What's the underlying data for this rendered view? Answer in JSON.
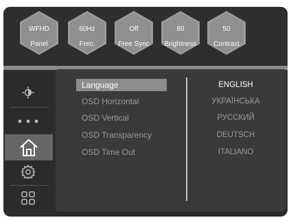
{
  "header": {
    "tiles": [
      {
        "line1": "WFHD",
        "line2": "Panel"
      },
      {
        "line1": "60Hz",
        "line2": "Frec."
      },
      {
        "line1": "Off",
        "line2": "Free Sync"
      },
      {
        "line1": "80",
        "line2": "Brightness"
      },
      {
        "line1": "50",
        "line2": "Contrast"
      }
    ]
  },
  "sidebar": {
    "items": [
      {
        "icon": "brightness-icon"
      },
      {
        "icon": "more-dots-icon"
      },
      {
        "icon": "home-icon",
        "active": true
      },
      {
        "icon": "gear-icon"
      },
      {
        "icon": "apps-grid-icon"
      }
    ]
  },
  "menu": {
    "items": [
      "Language",
      "OSD Horizontal",
      "OSD Vertical",
      "OSD Transparency",
      "OSD Time Out"
    ],
    "selected_index": 0
  },
  "options": {
    "items": [
      "ENGLISH",
      "УКРАЇНСЬКА",
      "РУССКИЙ",
      "DEUTSCH",
      "ITALIANO"
    ],
    "selected_index": 0
  },
  "colors": {
    "background": "#2b2b2b",
    "hex_tile": "#8f8f8f",
    "selected_row": "#8d8d8d",
    "active_sidebar": "#666666"
  }
}
